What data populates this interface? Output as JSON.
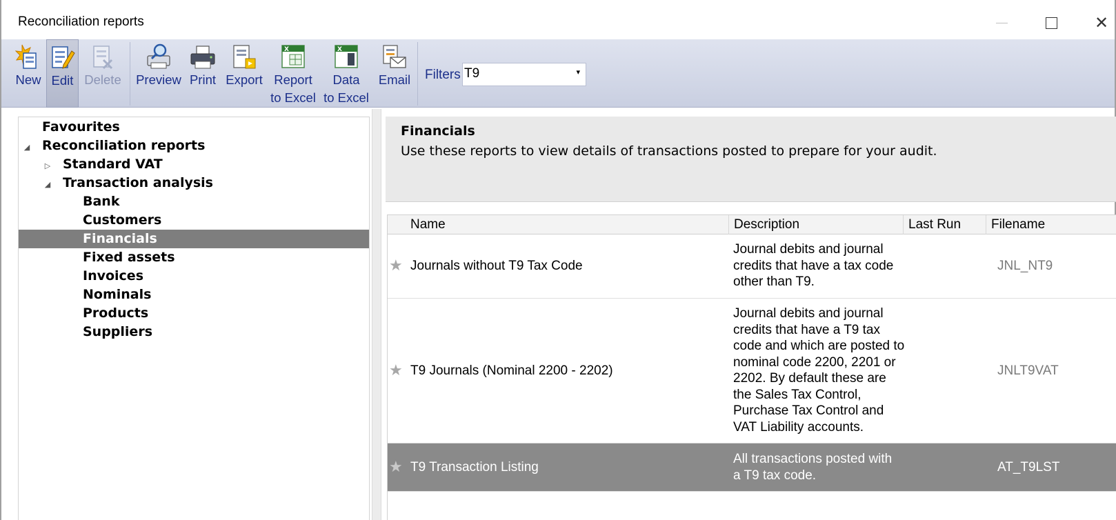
{
  "window": {
    "title": "Reconciliation reports"
  },
  "toolbar": {
    "buttons": [
      {
        "id": "new",
        "label": "New",
        "icon": "new-report-icon",
        "enabled": true
      },
      {
        "id": "edit",
        "label": "Edit",
        "icon": "edit-report-icon",
        "enabled": true,
        "active": true
      },
      {
        "id": "delete",
        "label": "Delete",
        "icon": "delete-report-icon",
        "enabled": false
      },
      {
        "id": "preview",
        "label": "Preview",
        "icon": "preview-icon",
        "enabled": true
      },
      {
        "id": "print",
        "label": "Print",
        "icon": "printer-icon",
        "enabled": true
      },
      {
        "id": "export",
        "label": "Export",
        "icon": "export-icon",
        "enabled": true
      },
      {
        "id": "report_to_excel",
        "label_line1": "Report",
        "label_line2": "to Excel",
        "icon": "excel-report-icon",
        "enabled": true
      },
      {
        "id": "data_to_excel",
        "label_line1": "Data",
        "label_line2": "to Excel",
        "icon": "excel-data-icon",
        "enabled": true
      },
      {
        "id": "email",
        "label": "Email",
        "icon": "email-icon",
        "enabled": true
      }
    ],
    "filters_label": "Filters",
    "filters_value": "T9"
  },
  "tree": {
    "items": [
      {
        "label": "Favourites",
        "level": 0,
        "toggle": ""
      },
      {
        "label": "Reconciliation reports",
        "level": 0,
        "toggle": "expanded"
      },
      {
        "label": "Standard VAT",
        "level": 1,
        "toggle": "collapsed"
      },
      {
        "label": "Transaction analysis",
        "level": 1,
        "toggle": "expanded"
      },
      {
        "label": "Bank",
        "level": 2,
        "toggle": ""
      },
      {
        "label": "Customers",
        "level": 2,
        "toggle": ""
      },
      {
        "label": "Financials",
        "level": 2,
        "toggle": "",
        "selected": true
      },
      {
        "label": "Fixed assets",
        "level": 2,
        "toggle": ""
      },
      {
        "label": "Invoices",
        "level": 2,
        "toggle": ""
      },
      {
        "label": "Nominals",
        "level": 2,
        "toggle": ""
      },
      {
        "label": "Products",
        "level": 2,
        "toggle": ""
      },
      {
        "label": "Suppliers",
        "level": 2,
        "toggle": ""
      }
    ]
  },
  "info": {
    "title": "Financials",
    "description": "Use these reports to view details of transactions posted to prepare for your audit."
  },
  "grid": {
    "columns": [
      "Name",
      "Description",
      "Last Run",
      "Filename"
    ],
    "rows": [
      {
        "name": "Journals without T9 Tax Code",
        "description_lines": [
          "Journal debits and journal",
          "credits that have a tax code",
          "other than T9."
        ],
        "last_run": "",
        "filename": "JNL_NT9",
        "selected": false
      },
      {
        "name": "T9 Journals (Nominal 2200 - 2202)",
        "description_lines": [
          "Journal debits and journal",
          "credits that have a T9 tax",
          "code and which are posted to",
          "nominal code 2200, 2201 or",
          "2202. By default these are",
          "the Sales Tax Control,",
          "Purchase Tax Control and",
          "VAT Liability accounts."
        ],
        "last_run": "",
        "filename": "JNLT9VAT",
        "selected": false
      },
      {
        "name": "T9 Transaction Listing",
        "description_lines": [
          "All transactions posted with",
          "a T9 tax code."
        ],
        "last_run": "",
        "filename": "AT_T9LST",
        "selected": true
      }
    ]
  },
  "colors": {
    "toolbar_text": "#1b2f8a",
    "selection": "#7e7e7e",
    "toolbar_bg": "#d4d9e8"
  }
}
